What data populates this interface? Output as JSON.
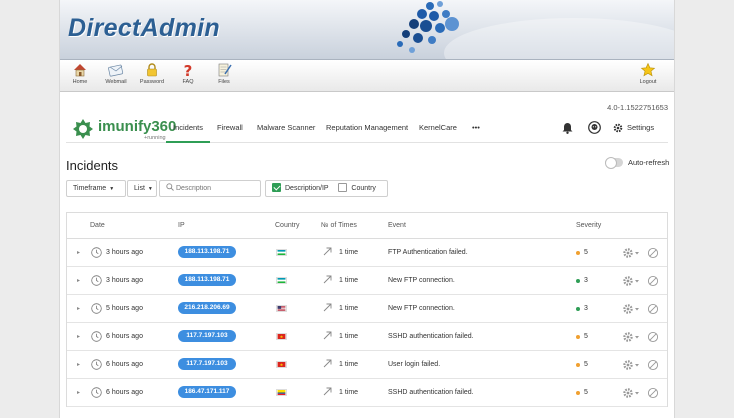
{
  "header": {
    "brand": "DirectAdmin",
    "colors": {
      "brand_blue": "#2c5f93",
      "bubble_blue": "#1f5ba8"
    }
  },
  "toolbar": {
    "items": [
      {
        "label": "Home",
        "icon": "house-icon"
      },
      {
        "label": "Webmail",
        "icon": "mail-icon"
      },
      {
        "label": "Password",
        "icon": "lock-icon"
      },
      {
        "label": "FAQ",
        "icon": "question-icon"
      },
      {
        "label": "Files",
        "icon": "notepad-icon"
      },
      {
        "label": "Logout",
        "icon": "star-icon"
      }
    ]
  },
  "version": "4.0-1.1522751653",
  "imunify": {
    "logo_text": "imunify360",
    "logo_sub": "+running",
    "nav": [
      "Incidents",
      "Firewall",
      "Malware Scanner",
      "Reputation Management",
      "KernelCare",
      "•••"
    ],
    "active_nav": "Incidents",
    "settings_label": "Settings",
    "accent": "#2f9e56"
  },
  "page": {
    "title": "Incidents",
    "auto_refresh_label": "Auto-refresh",
    "auto_refresh_on": false
  },
  "filters": {
    "timeframe_label": "Timeframe",
    "list_label": "List",
    "search_placeholder": "Description",
    "description_ip_label": "Description/IP",
    "description_ip_checked": true,
    "country_label": "Country",
    "country_checked": false
  },
  "table": {
    "columns": [
      "Date",
      "IP",
      "Country",
      "№ of Times",
      "Event",
      "Severity"
    ],
    "rows": [
      {
        "date": "3 hours ago",
        "ip": "188.113.198.71",
        "flag": "uz",
        "times": "1 time",
        "event": "FTP Authentication failed.",
        "severity": "5",
        "severity_color": "#f0a030"
      },
      {
        "date": "3 hours ago",
        "ip": "188.113.198.71",
        "flag": "uz",
        "times": "1 time",
        "event": "New FTP connection.",
        "severity": "3",
        "severity_color": "#2f9e56"
      },
      {
        "date": "5 hours ago",
        "ip": "216.218.206.69",
        "flag": "us",
        "times": "1 time",
        "event": "New FTP connection.",
        "severity": "3",
        "severity_color": "#2f9e56"
      },
      {
        "date": "6 hours ago",
        "ip": "117.7.197.103",
        "flag": "vn",
        "times": "1 time",
        "event": "SSHD authentication failed.",
        "severity": "5",
        "severity_color": "#f0a030"
      },
      {
        "date": "6 hours ago",
        "ip": "117.7.197.103",
        "flag": "vn",
        "times": "1 time",
        "event": "User login failed.",
        "severity": "5",
        "severity_color": "#f0a030"
      },
      {
        "date": "6 hours ago",
        "ip": "186.47.171.117",
        "flag": "ec",
        "times": "1 time",
        "event": "SSHD authentication failed.",
        "severity": "5",
        "severity_color": "#f0a030"
      }
    ]
  }
}
